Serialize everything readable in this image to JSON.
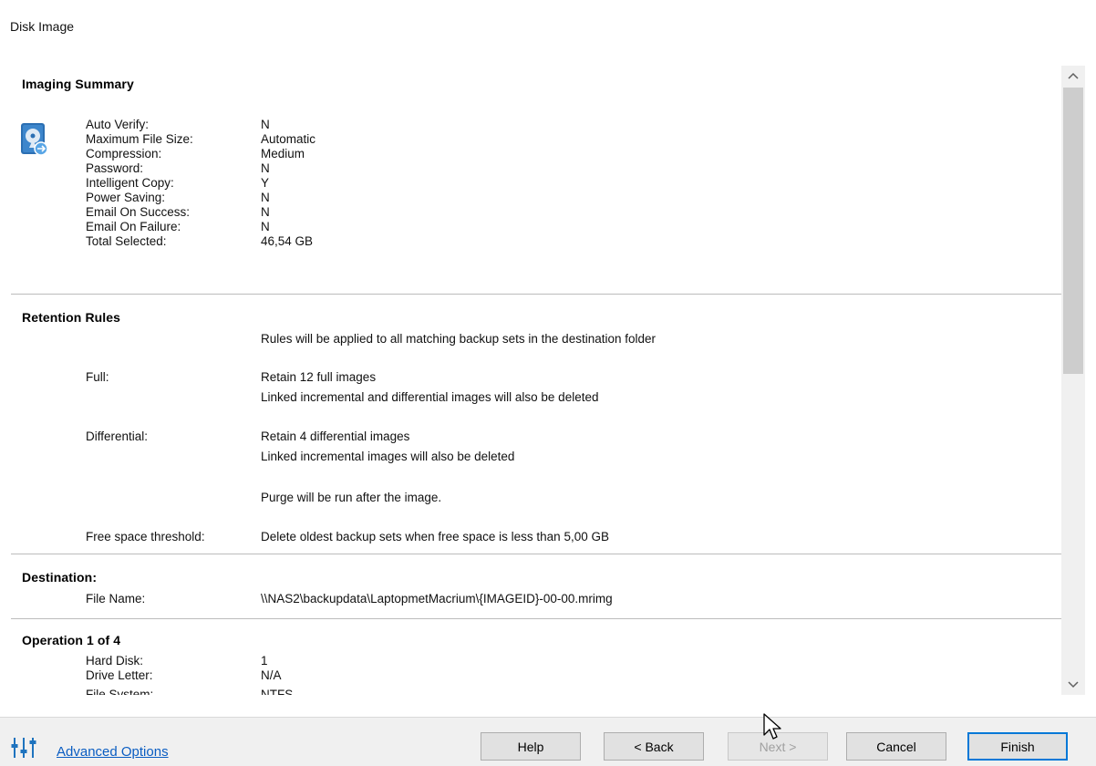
{
  "window": {
    "title": "Disk Image"
  },
  "summary": {
    "imaging": {
      "heading": "Imaging Summary",
      "rows": [
        {
          "key": "Auto Verify:",
          "value": "N"
        },
        {
          "key": "Maximum File Size:",
          "value": "Automatic"
        },
        {
          "key": "Compression:",
          "value": "Medium"
        },
        {
          "key": "Password:",
          "value": "N"
        },
        {
          "key": "Intelligent Copy:",
          "value": "Y"
        },
        {
          "key": "Power Saving:",
          "value": "N"
        },
        {
          "key": "Email On Success:",
          "value": "N"
        },
        {
          "key": "Email On Failure:",
          "value": "N"
        },
        {
          "key": "Total Selected:",
          "value": "46,54 GB"
        }
      ]
    },
    "retention": {
      "heading": "Retention Rules",
      "intro": "Rules will be applied to all matching backup sets in the destination folder",
      "full_key": "Full:",
      "full_line1": "Retain 12 full images",
      "full_line2": "Linked incremental and differential images will also be deleted",
      "diff_key": "Differential:",
      "diff_line1": "Retain 4 differential images",
      "diff_line2": "Linked incremental images will also be deleted",
      "purge": "Purge will be run after the image.",
      "threshold_key": "Free space threshold:",
      "threshold_value": "Delete oldest backup sets when free space is less than 5,00 GB"
    },
    "destination": {
      "heading": "Destination:",
      "file_key": "File Name:",
      "file_value": "\\\\NAS2\\backupdata\\LaptopmetMacrium\\{IMAGEID}-00-00.mrimg"
    },
    "operation": {
      "heading": "Operation 1 of 4",
      "rows": [
        {
          "key": "Hard Disk:",
          "value": "1"
        },
        {
          "key": "Drive Letter:",
          "value": "N/A"
        },
        {
          "key": "File System:",
          "value": "NTFS"
        }
      ]
    }
  },
  "footer": {
    "advanced_options": "Advanced Options",
    "buttons": {
      "help": "Help",
      "back": "< Back",
      "next": "Next >",
      "cancel": "Cancel",
      "finish": "Finish"
    }
  },
  "colors": {
    "link": "#0a5dc2",
    "default_button_border": "#0078d7",
    "icon_blue": "#1e73be"
  },
  "icons": [
    "disk-image-icon",
    "scroll-up-icon",
    "scroll-down-icon",
    "advanced-options-icon",
    "mouse-cursor-icon"
  ]
}
